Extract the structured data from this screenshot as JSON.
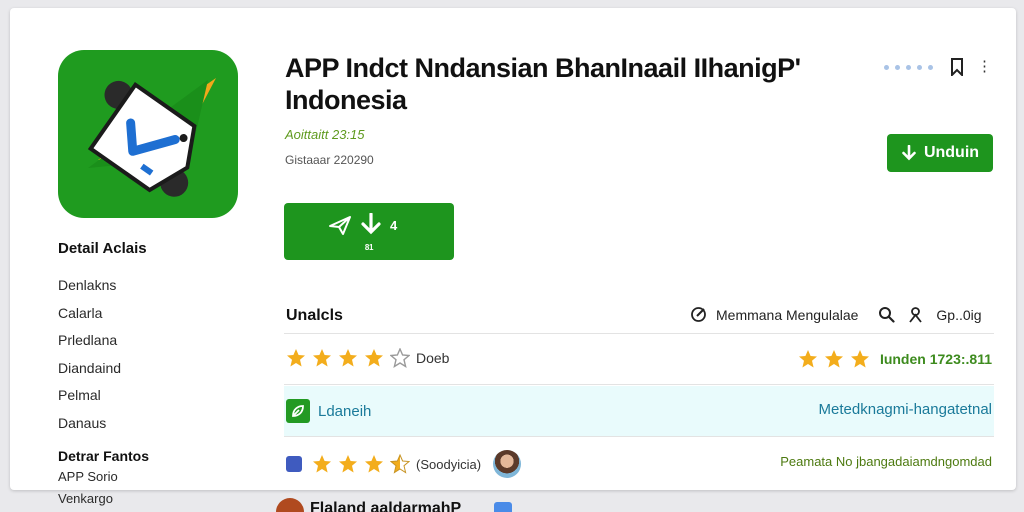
{
  "app": {
    "title_line1": "APP Indct Nndansian BhanInaail IIhanigP'",
    "title_line2": "Indonesia",
    "rating_line": "Aoittaitt 23:15",
    "meta_line": "Gistaaar 220290"
  },
  "buttons": {
    "unduh_label": "Unduin",
    "big_number": "4",
    "big_sub": "81"
  },
  "sidebar": {
    "title": "Detail Aclais",
    "items": [
      "Denlakns",
      "Calarla",
      "Prledlana",
      "Diandaind",
      "Pelmal",
      "Danaus"
    ],
    "subtitle": "Detrar Fantos",
    "items2": [
      "APP Sorio",
      "Venkargo"
    ]
  },
  "section": {
    "heading": "Unalcls",
    "tool1_label": "Memmana Mengulalae",
    "tool2_label": "Gp..0ig"
  },
  "rows": [
    {
      "left_label": "Doeb",
      "left_stars": 4,
      "right_text": "Iunden 1723:.811",
      "right_stars": 3
    },
    {
      "left_label": "Ldaneih",
      "right_text": "Metedknagmi-hangatetnal"
    },
    {
      "left_label": "(Soodyicia)",
      "left_stars": 3.5,
      "right_text": "Peamata No jbangadaiamdngomdad"
    }
  ],
  "footer_peek": {
    "text": "Flaland aaldarmahP"
  },
  "colors": {
    "brand_green": "#1e951e",
    "star": "#f3ad1c",
    "highlight_row": "#e9fbfc",
    "teal": "#1a7a9a"
  }
}
